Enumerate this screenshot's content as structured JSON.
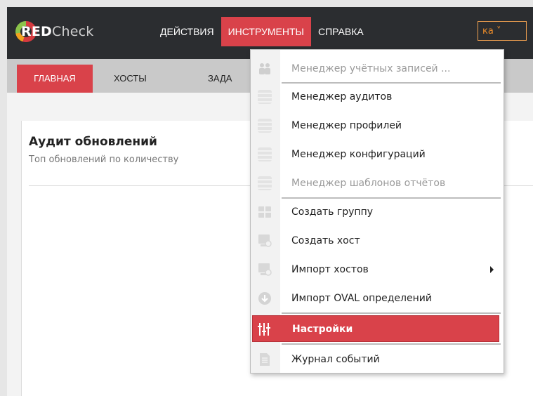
{
  "brand": {
    "bold": "RED",
    "light": "Check"
  },
  "menubar": {
    "items": [
      "ДЕЙСТВИЯ",
      "ИНСТРУМЕНТЫ",
      "СПРАВКА"
    ],
    "active": "ИНСТРУМЕНТЫ"
  },
  "tabs": [
    "ГЛАВНАЯ",
    "ХОСТЫ",
    "ЗАДА"
  ],
  "card": {
    "title": "Аудит обновлений",
    "subtitle": "Топ обновлений по количеству",
    "right_button": "ка"
  },
  "dropdown": {
    "items": [
      {
        "label": "Менеджер учётных записей ...",
        "icon": "users-icon",
        "disabled": true
      },
      {
        "label": "Менеджер аудитов",
        "icon": "database-icon",
        "disabled": false
      },
      {
        "label": "Менеджер профилей",
        "icon": "database-icon",
        "disabled": false
      },
      {
        "label": "Менеджер конфигураций",
        "icon": "database-icon",
        "disabled": false
      },
      {
        "label": "Менеджер шаблонов отчётов",
        "icon": "database-icon",
        "disabled": true
      },
      {
        "label": "Создать группу",
        "icon": "group-icon",
        "disabled": false
      },
      {
        "label": "Создать хост",
        "icon": "add-host-icon",
        "disabled": false
      },
      {
        "label": "Импорт хостов",
        "icon": "import-host-icon",
        "disabled": false,
        "submenu": true
      },
      {
        "label": "Импорт OVAL определений",
        "icon": "download-icon",
        "disabled": false
      },
      {
        "label": "Настройки",
        "icon": "sliders-icon",
        "disabled": false,
        "selected": true
      },
      {
        "label": "Журнал событий",
        "icon": "document-icon",
        "disabled": false
      }
    ]
  },
  "colors": {
    "accent": "#d9424a",
    "topbar": "#2b2d30",
    "orange": "#e88a2a"
  }
}
